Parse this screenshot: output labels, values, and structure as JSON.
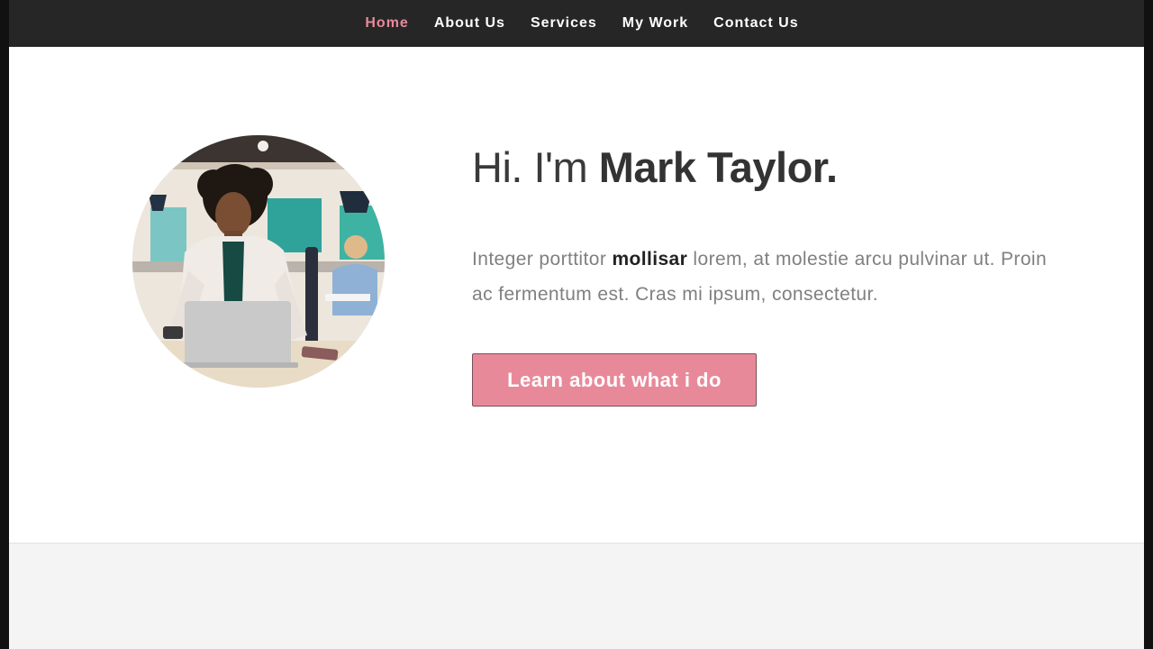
{
  "nav": {
    "items": [
      {
        "label": "Home",
        "active": true
      },
      {
        "label": "About Us",
        "active": false
      },
      {
        "label": "Services",
        "active": false
      },
      {
        "label": "My Work",
        "active": false
      },
      {
        "label": "Contact Us",
        "active": false
      }
    ]
  },
  "hero": {
    "headline_prefix": "Hi. I'm ",
    "headline_name": "Mark Taylor.",
    "intro_before": "Integer porttitor ",
    "intro_bold": "mollisar",
    "intro_after": " lorem, at molestie arcu pulvinar ut. Proin ac fermentum est. Cras mi ipsum, consectetur.",
    "cta_label": "Learn about what i do"
  },
  "colors": {
    "accent": "#e8899a",
    "navbar_bg": "#262626",
    "heading_text": "#333333",
    "body_text": "#808080",
    "lower_section_bg": "#f4f4f4"
  }
}
